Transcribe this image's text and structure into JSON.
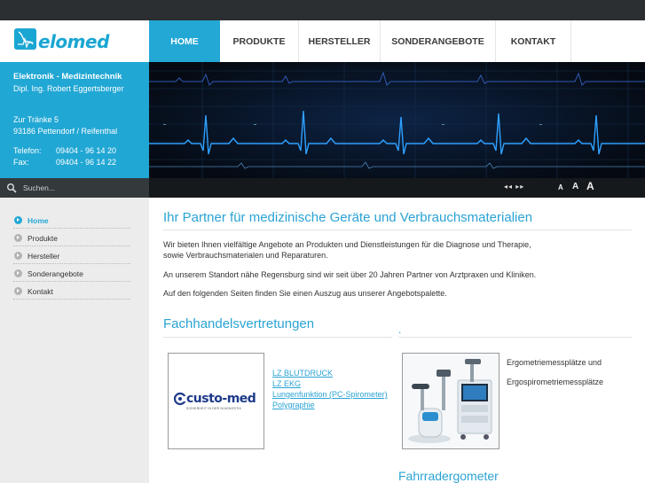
{
  "brand": {
    "logo_text": "elomed"
  },
  "nav": {
    "items": [
      {
        "label": "HOME",
        "active": true
      },
      {
        "label": "PRODUKTE",
        "active": false
      },
      {
        "label": "HERSTELLER",
        "active": false
      },
      {
        "label": "SONDERANGEBOTE",
        "active": false
      },
      {
        "label": "KONTAKT",
        "active": false
      }
    ]
  },
  "contact": {
    "company": "Elektronik - Medizintechnik",
    "person": "Dipl. Ing. Robert Eggertsberger",
    "street": "Zur Tränke 5",
    "city": "93186 Pettendorf / Reifenthal",
    "phone_label": "Telefon:",
    "phone": "09404 - 96 14 20",
    "fax_label": "Fax:",
    "fax": "09404 - 96 14 22"
  },
  "search": {
    "placeholder": "Suchen..."
  },
  "toolbar": {
    "arrows": "◂◂ ▸▸",
    "font_sizes": [
      "A",
      "A",
      "A"
    ]
  },
  "sidebar": {
    "items": [
      {
        "label": "Home",
        "active": true
      },
      {
        "label": "Produkte",
        "active": false
      },
      {
        "label": "Hersteller",
        "active": false
      },
      {
        "label": "Sonderangebote",
        "active": false
      },
      {
        "label": "Kontakt",
        "active": false
      }
    ]
  },
  "main": {
    "title": "Ihr Partner für medizinische Geräte und Verbrauchsmaterialien",
    "intro_line1": "Wir bieten Ihnen vielfältige Angebote an Produkten und Dienstleistungen für die Diagnose und Therapie,",
    "intro_line2": "sowie Verbrauchsmaterialen und Reparaturen.",
    "para2": "An unserem Standort nähe Regensburg sind wir seit über 20 Jahren Partner von Arztpraxen und Kliniken.",
    "para3": "Auf den folgenden Seiten finden Sie einen Auszug aus unserer Angebotspalette.",
    "section_title": "Fachhandelsvertretungen",
    "section_dot": ".",
    "partner": {
      "logo_name": "custo-med",
      "logo_tagline": "SICHERHEIT IN DER DIAGNOSTIK",
      "links": [
        "LZ BLUTDRUCK",
        "LZ EKG",
        "Lungenfunktion (PC-Spirometer)",
        "Polygraphie"
      ]
    },
    "ergo": {
      "line1": "Ergometriemessplätze und",
      "line2": "Ergospirometriemessplätze"
    },
    "bottom_heading": "Fahrradergometer"
  },
  "colors": {
    "accent": "#23a8d6",
    "topbar": "#2b2f31",
    "sidebar": "#ececec",
    "banner": "#07101d"
  }
}
